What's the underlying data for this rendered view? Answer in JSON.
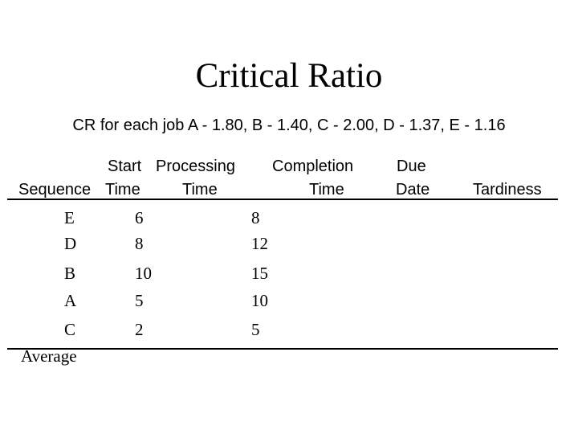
{
  "slide": {
    "title": "Critical Ratio",
    "subtitle": "CR for each job A - 1.80, B - 1.40, C - 2.00, D - 1.37, E - 1.16"
  },
  "table": {
    "headers": {
      "sequence": "Sequence",
      "start_line1": "Start",
      "start_line2": "Time",
      "processing_line1": "Processing",
      "processing_line2": "Time",
      "completion_line1": "Completion",
      "completion_line2": "Time",
      "due_line1": "Due",
      "due_line2": "Date",
      "tardiness": "Tardiness"
    },
    "rows": [
      {
        "job": "E",
        "start": "6",
        "processing": "8"
      },
      {
        "job": "D",
        "start": "8",
        "processing": "12"
      },
      {
        "job": "B",
        "start": "10",
        "processing": "15"
      },
      {
        "job": "A",
        "start": "5",
        "processing": "10"
      },
      {
        "job": "C",
        "start": "2",
        "processing": "5"
      }
    ],
    "footer_label": "Average"
  }
}
